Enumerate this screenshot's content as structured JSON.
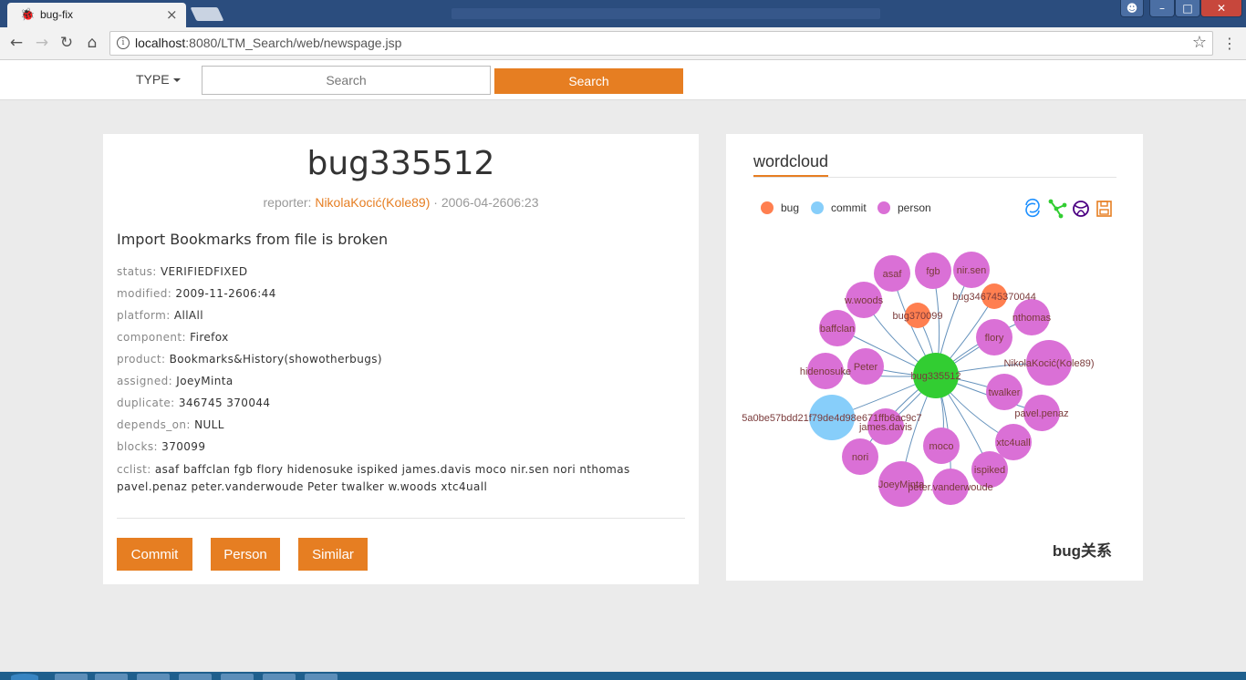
{
  "browser": {
    "tab_title": "bug-fix",
    "url_host": "localhost",
    "url_path": ":8080/LTM_Search/web/newspage.jsp"
  },
  "header": {
    "type_label": "TYPE",
    "search_placeholder": "Search",
    "search_button": "Search"
  },
  "bug": {
    "title": "bug335512",
    "reporter_label": "reporter:",
    "reporter_name": "NikolaKocić(Kole89)",
    "date": " · 2006-04-2606:23",
    "summary": "Import Bookmarks from file is broken",
    "fields": [
      {
        "key": "status:",
        "value": "VERIFIEDFIXED"
      },
      {
        "key": "modified:",
        "value": "2009-11-2606:44"
      },
      {
        "key": "platform:",
        "value": "AllAll"
      },
      {
        "key": "component:",
        "value": "Firefox"
      },
      {
        "key": "product:",
        "value": "Bookmarks&History(showotherbugs)"
      },
      {
        "key": "assigned:",
        "value": "JoeyMinta"
      },
      {
        "key": "duplicate:",
        "value": "346745 370044"
      },
      {
        "key": "depends_on:",
        "value": "NULL"
      },
      {
        "key": "blocks:",
        "value": "370099"
      }
    ],
    "cclist_key": "cclist:",
    "cclist_value": "asaf baffclan fgb flory hidenosuke ispiked james.davis moco nir.sen nori nthomas pavel.penaz peter.vanderwoude Peter twalker w.woods xtc4uall",
    "buttons": {
      "commit": "Commit",
      "person": "Person",
      "similar": "Similar"
    }
  },
  "graph_panel": {
    "title": "wordcloud",
    "caption": "bug关系",
    "legend": [
      {
        "label": "bug",
        "color": "#ff7f50"
      },
      {
        "label": "commit",
        "color": "#87cefa"
      },
      {
        "label": "person",
        "color": "#da70d6"
      }
    ],
    "toolbox_icons": [
      "restore-icon",
      "force-layout-icon",
      "chord-icon",
      "save-image-icon"
    ],
    "center": {
      "label": "bug335512",
      "category": "center",
      "color": "#32cd32"
    },
    "nodes": [
      {
        "label": "asaf",
        "category": "person"
      },
      {
        "label": "fgb",
        "category": "person"
      },
      {
        "label": "nir.sen",
        "category": "person"
      },
      {
        "label": "bug346745370044",
        "category": "bug"
      },
      {
        "label": "w.woods",
        "category": "person"
      },
      {
        "label": "bug370099",
        "category": "bug"
      },
      {
        "label": "nthomas",
        "category": "person"
      },
      {
        "label": "baffclan",
        "category": "person"
      },
      {
        "label": "flory",
        "category": "person"
      },
      {
        "label": "NikolaKocić(Kole89)",
        "category": "person"
      },
      {
        "label": "hidenosuke",
        "category": "person"
      },
      {
        "label": "Peter",
        "category": "person"
      },
      {
        "label": "twalker",
        "category": "person"
      },
      {
        "label": "pavel.penaz",
        "category": "person"
      },
      {
        "label": "5a0be57bdd21f79de4d98e671ffb6ac9c7",
        "category": "commit"
      },
      {
        "label": "james.davis",
        "category": "person"
      },
      {
        "label": "xtc4uall",
        "category": "person"
      },
      {
        "label": "moco",
        "category": "person"
      },
      {
        "label": "nori",
        "category": "person"
      },
      {
        "label": "ispiked",
        "category": "person"
      },
      {
        "label": "JoeyMinta",
        "category": "person"
      },
      {
        "label": "peter.vanderwoude",
        "category": "person"
      }
    ]
  }
}
